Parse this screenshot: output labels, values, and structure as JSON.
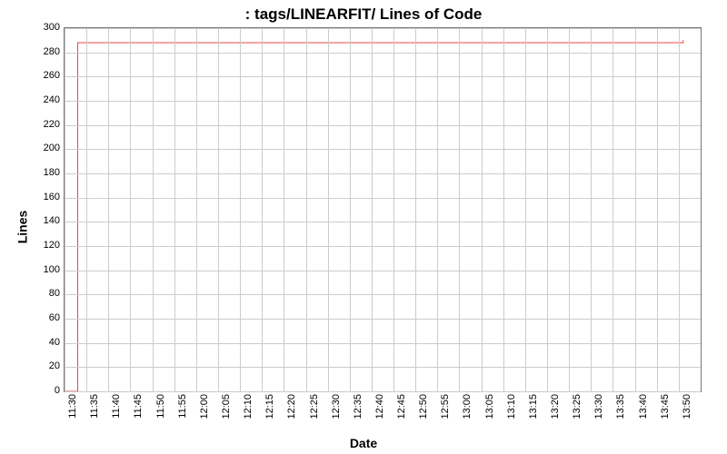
{
  "chart_data": {
    "type": "line",
    "title": ": tags/LINEARFIT/ Lines of Code",
    "xlabel": "Date",
    "ylabel": "Lines",
    "ylim": [
      0,
      300
    ],
    "y_ticks": [
      0,
      20,
      40,
      60,
      80,
      100,
      120,
      140,
      160,
      180,
      200,
      220,
      240,
      260,
      280,
      300
    ],
    "x_ticks": [
      "11:30",
      "11:35",
      "11:40",
      "11:45",
      "11:50",
      "11:55",
      "12:00",
      "12:05",
      "12:10",
      "12:15",
      "12:20",
      "12:25",
      "12:30",
      "12:35",
      "12:40",
      "12:45",
      "12:50",
      "12:55",
      "13:00",
      "13:05",
      "13:10",
      "13:15",
      "13:20",
      "13:25",
      "13:30",
      "13:35",
      "13:40",
      "13:45",
      "13:50"
    ],
    "series": [
      {
        "name": "tags/LINEARFIT/",
        "color": "#e44",
        "x": [
          "11:30",
          "11:33",
          "11:33",
          "13:50",
          "13:51",
          "13:51"
        ],
        "values": [
          0,
          0,
          288,
          288,
          288,
          290
        ]
      }
    ]
  }
}
